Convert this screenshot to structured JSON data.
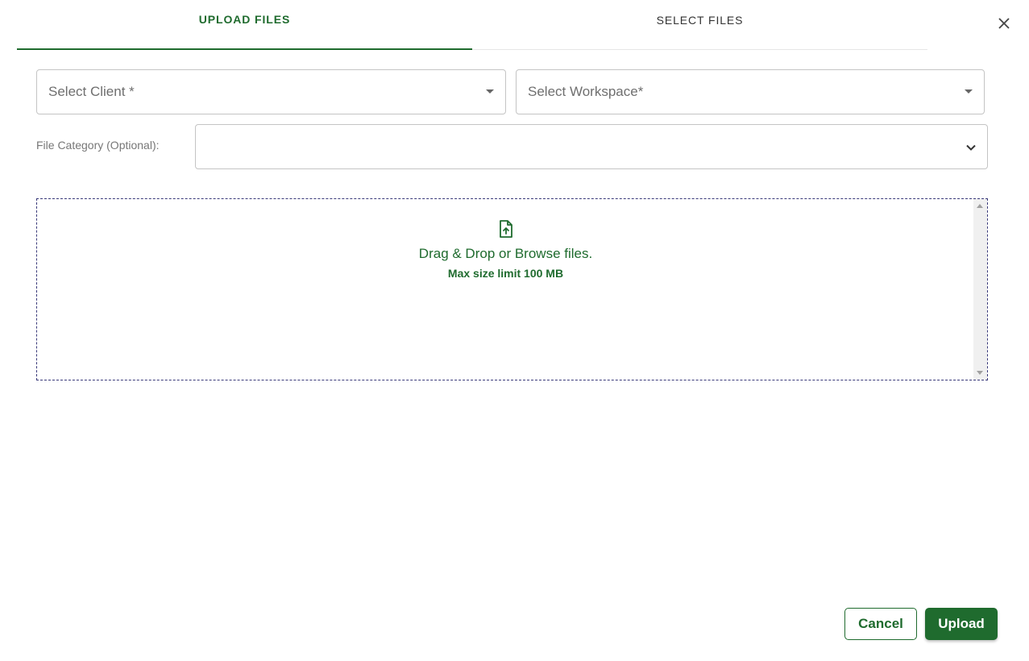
{
  "tabs": [
    {
      "label": "UPLOAD FILES",
      "active": true
    },
    {
      "label": "SELECT FILES",
      "active": false
    }
  ],
  "form": {
    "client_placeholder": "Select Client *",
    "workspace_placeholder": "Select Workspace*",
    "category_label": "File Category (Optional):",
    "category_value": ""
  },
  "dropzone": {
    "text": "Drag & Drop or Browse files.",
    "limit": "Max size limit 100 MB",
    "icon": "file-upload-icon"
  },
  "footer": {
    "cancel_label": "Cancel",
    "upload_label": "Upload"
  },
  "colors": {
    "accent": "#1f6b2e",
    "border": "#c4c4c4",
    "dropzone_border": "#3a3a7a"
  }
}
